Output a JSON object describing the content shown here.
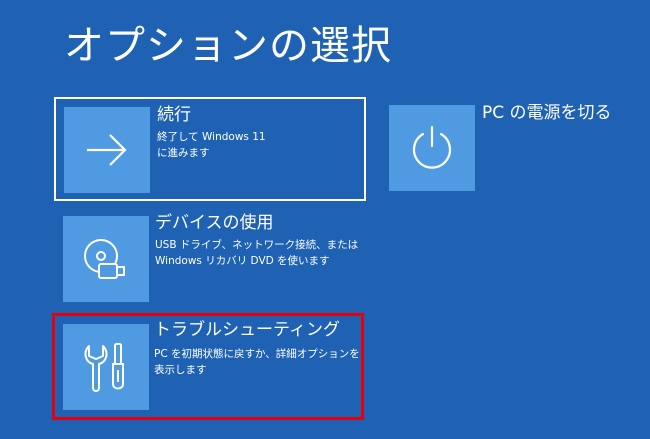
{
  "page": {
    "title": "オプションの選択"
  },
  "options": {
    "continue": {
      "label": "続行",
      "description": "終了して Windows 11\nに進みます",
      "icon": "arrow-right-icon"
    },
    "use_device": {
      "label": "デバイスの使用",
      "description": "USB ドライブ、ネットワーク接続、または\nWindows リカバリ DVD を使います",
      "icon": "disc-usb-icon"
    },
    "troubleshoot": {
      "label": "トラブルシューティング",
      "description": "PC を初期状態に戻すか、詳細オプションを\n表示します",
      "icon": "tools-icon"
    },
    "power_off": {
      "label": "PC の電源を切る",
      "icon": "power-icon"
    }
  },
  "colors": {
    "background": "#1f62b4",
    "tile": "#4f9ae0",
    "focus_border": "#ffffff",
    "highlight_border": "#e3000f"
  }
}
